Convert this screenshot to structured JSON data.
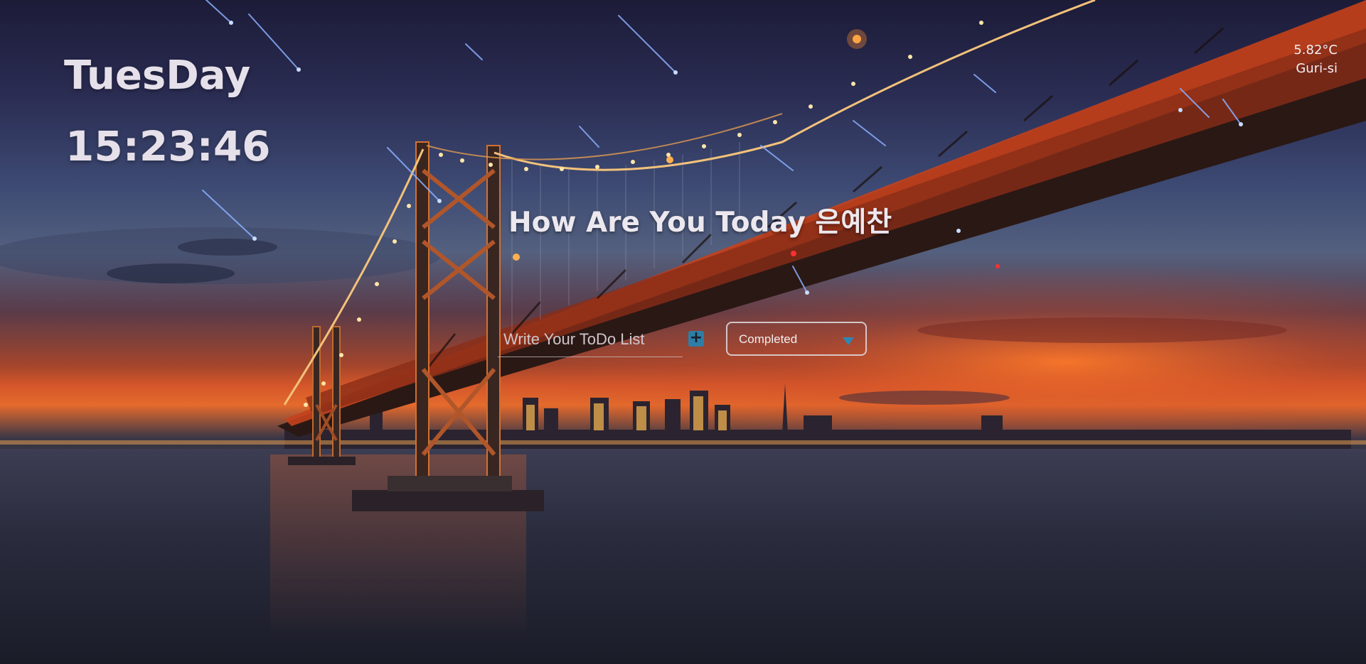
{
  "clock": {
    "day": "TuesDay",
    "time": "15:23:46"
  },
  "weather": {
    "temperature": "5.82°C",
    "location": "Guri-si"
  },
  "greeting": {
    "text": "How Are You Today 은예찬"
  },
  "todo": {
    "placeholder": "Write Your ToDo List",
    "add_icon": "plus-icon"
  },
  "filter": {
    "selected": "Completed",
    "caret_icon": "caret-down-icon"
  },
  "colors": {
    "accent": "#2d7ea6",
    "text": "#e6e0ea"
  }
}
